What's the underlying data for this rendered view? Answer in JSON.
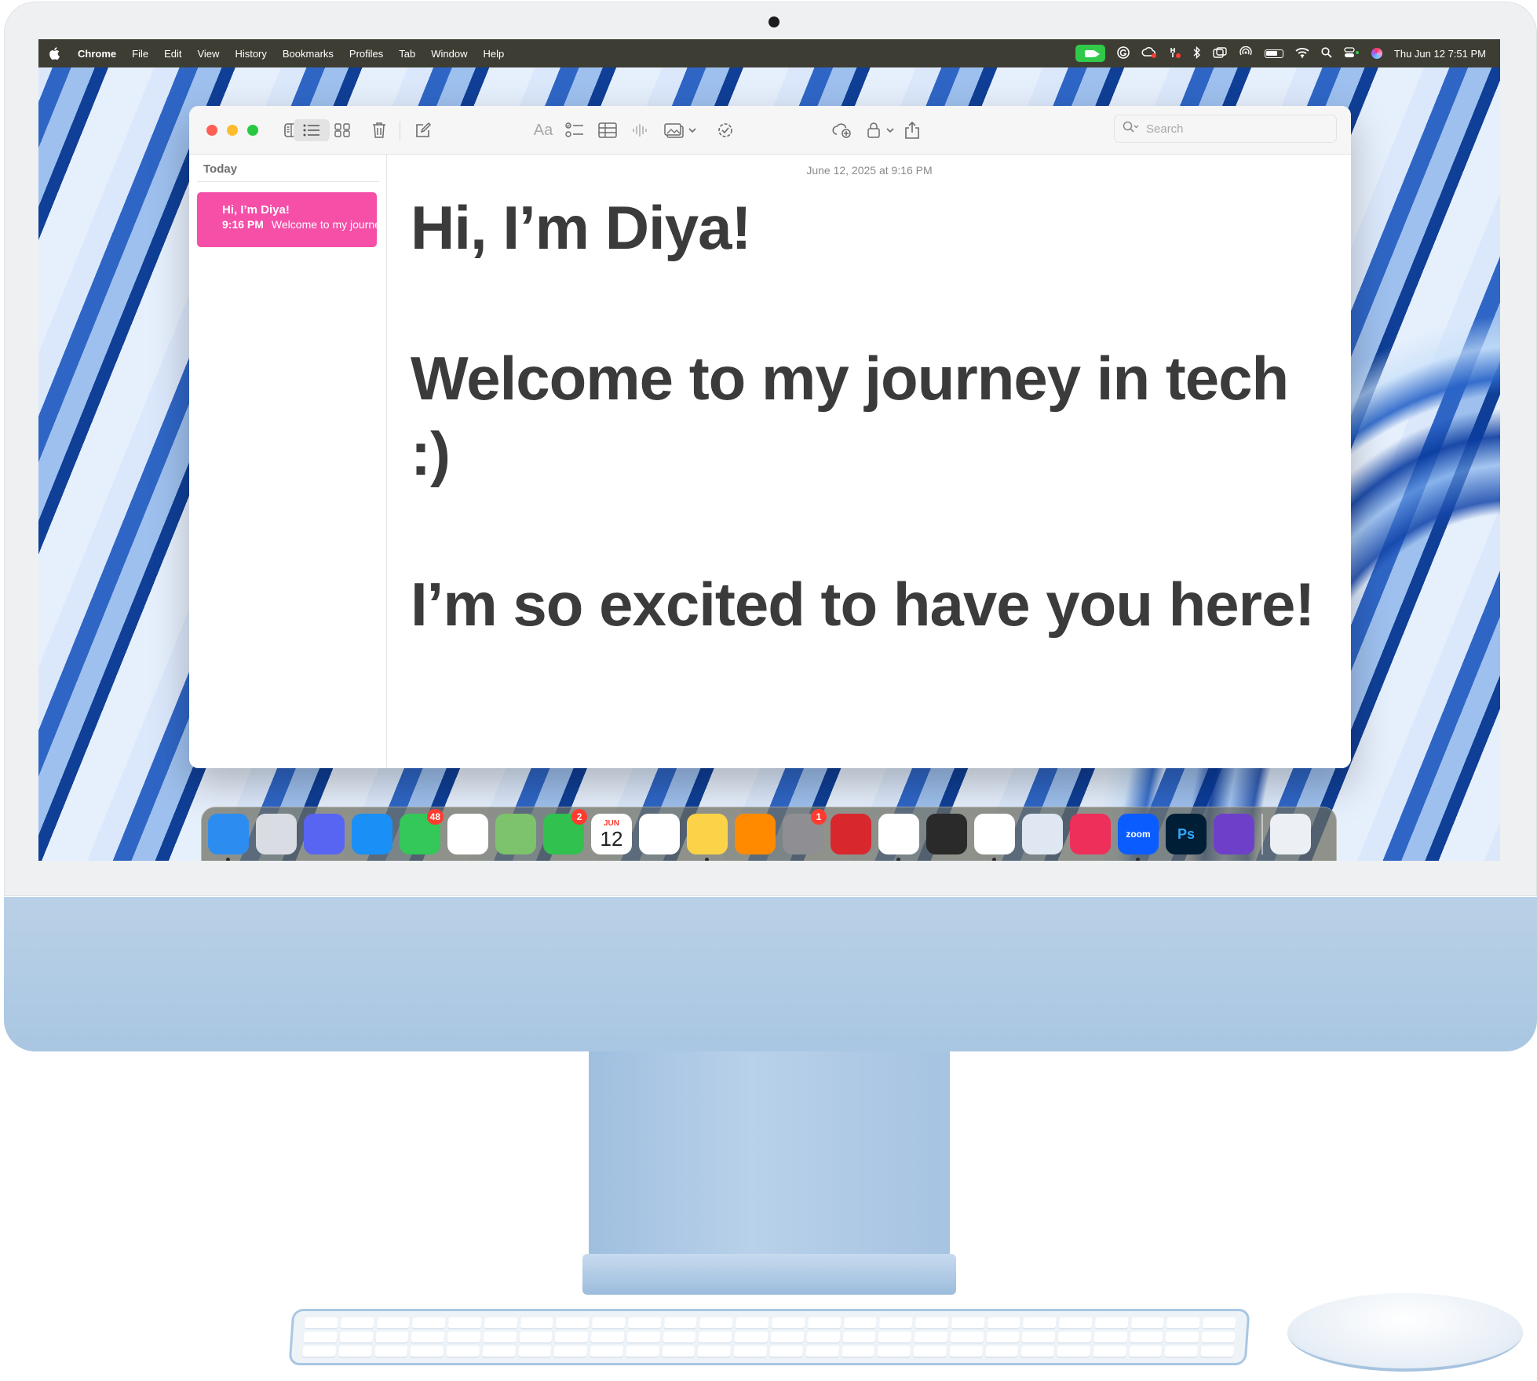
{
  "menubar": {
    "app_name": "Chrome",
    "menus": [
      "File",
      "Edit",
      "View",
      "History",
      "Bookmarks",
      "Profiles",
      "Tab",
      "Window",
      "Help"
    ],
    "clock": "Thu Jun 12  7:51 PM",
    "status_icons": [
      "facetime-camera-icon",
      "grammarly-icon",
      "creative-cloud-icon",
      "vpn-icon",
      "bluetooth-icon",
      "screen-mirroring-icon",
      "airdrop-icon",
      "battery-icon",
      "wifi-icon",
      "spotlight-search-icon",
      "control-center-icon",
      "siri-icon"
    ]
  },
  "notes": {
    "toolbar": {
      "format_label": "Aa",
      "search_placeholder": "Search"
    },
    "sidebar": {
      "section": "Today",
      "items": [
        {
          "title": "Hi, I’m Diya!",
          "time": "9:16 PM",
          "preview": "Welcome to my journey"
        }
      ]
    },
    "editor": {
      "date": "June 12, 2025 at 9:16 PM",
      "lines": [
        "Hi, I’m Diya!",
        "Welcome to my journey in tech :)",
        "I’m so excited to have you here!"
      ]
    }
  },
  "dock": {
    "apps": [
      {
        "name": "Finder",
        "color": "#2d8cf0",
        "running": true
      },
      {
        "name": "Launchpad",
        "color": "#d9dde3"
      },
      {
        "name": "Discord",
        "color": "#5865f2"
      },
      {
        "name": "Safari",
        "color": "#1a8ff5"
      },
      {
        "name": "Messages",
        "color": "#34c759",
        "badge": "48"
      },
      {
        "name": "Photos",
        "color": "#ffffff"
      },
      {
        "name": "Maps",
        "color": "#7cc36b"
      },
      {
        "name": "FaceTime",
        "color": "#30c14f",
        "badge": "2"
      },
      {
        "name": "Calendar",
        "month": "JUN",
        "day": "12"
      },
      {
        "name": "Reminders",
        "color": "#ffffff"
      },
      {
        "name": "Notes",
        "color": "#fbd348",
        "running": true
      },
      {
        "name": "Books",
        "color": "#ff8a00"
      },
      {
        "name": "System Settings",
        "color": "#8e8e93",
        "badge": "1"
      },
      {
        "name": "Photo Booth",
        "color": "#d9272e"
      },
      {
        "name": "Chrome",
        "color": "#ffffff",
        "running": true
      },
      {
        "name": "QuickTime Player",
        "color": "#2a2a2a"
      },
      {
        "name": "Visual Studio Code",
        "color": "#ffffff",
        "running": true
      },
      {
        "name": "Preview",
        "color": "#dfe7f2"
      },
      {
        "name": "Creative Cloud",
        "color": "#ed2f5a"
      },
      {
        "name": "Zoom",
        "color": "#0b5cff",
        "label": "zoom",
        "running": true
      },
      {
        "name": "Photoshop",
        "color": "#001e36",
        "label": "Ps"
      },
      {
        "name": "GitHub Desktop",
        "color": "#6e40c9"
      },
      {
        "name": "Trash",
        "color": "#eceff3"
      }
    ]
  }
}
